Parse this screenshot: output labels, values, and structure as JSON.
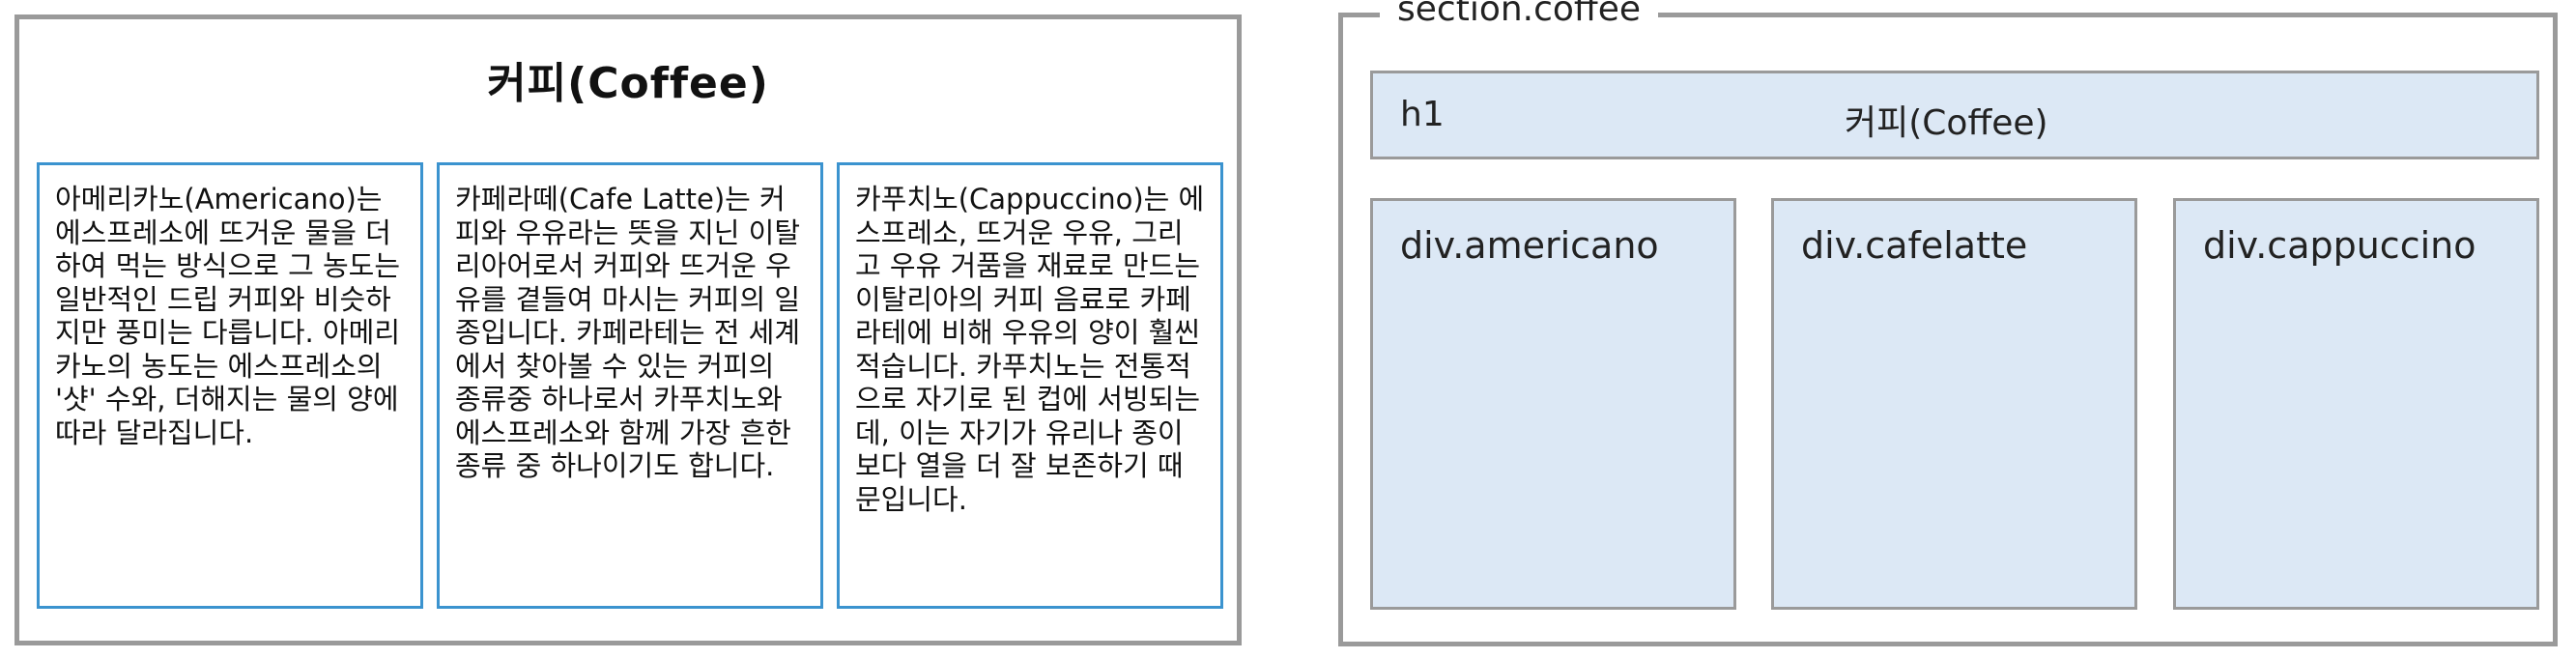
{
  "left": {
    "title": "커피(Coffee)",
    "columns": [
      {
        "text": "아메리카노(Americano)는 에스프레소에 뜨거운 물을 더하여 먹는 방식으로 그 농도는 일반적인 드립 커피와 비슷하지만 풍미는 다릅니다. 아메리카노의 농도는 에스프레소의 '샷' 수와, 더해지는 물의 양에 따라 달라집니다."
      },
      {
        "text": "카페라떼(Cafe Latte)는 커피와 우유라는 뜻을 지닌 이탈리아어로서 커피와 뜨거운 우유를 곁들여 마시는 커피의 일종입니다. 카페라테는 전 세계에서 찾아볼 수 있는 커피의 종류중 하나로서 카푸치노와 에스프레소와 함께 가장 흔한 종류 중 하나이기도 합니다."
      },
      {
        "text": "카푸치노(Cappuccino)는 에스프레소, 뜨거운 우유, 그리고 우유 거품을 재료로 만드는 이탈리아의 커피 음료로 카페라테에 비해 우유의 양이 훨씬 적습니다. 카푸치노는 전통적으로 자기로 된 컵에 서빙되는데, 이는 자기가 유리나 종이보다 열을 더 잘 보존하기 때문입니다."
      }
    ]
  },
  "right": {
    "section_label": "section.coffee",
    "h1_tag": "h1",
    "h1_text": "커피(Coffee)",
    "boxes": [
      {
        "label": "div.americano"
      },
      {
        "label": "div.cafelatte"
      },
      {
        "label": "div.cappuccino"
      }
    ]
  }
}
